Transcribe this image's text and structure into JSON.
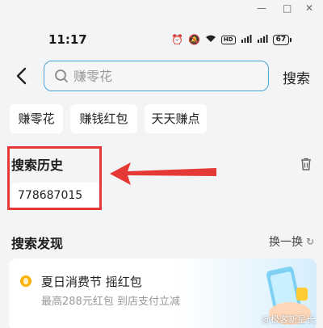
{
  "window": {
    "minimize_glyph": "—",
    "restore_glyph": "□",
    "close_glyph": "✕"
  },
  "status": {
    "time": "11:17",
    "icons": [
      "alarm-icon",
      "mute-icon",
      "wifi-icon",
      "hd-icon",
      "signal-5g-icon",
      "signal-4g-icon",
      "battery-icon"
    ],
    "hd_label": "HD",
    "battery_level": "67"
  },
  "header": {
    "search_placeholder": "赚零花",
    "search_button": "搜索"
  },
  "suggestions": [
    "赚零花",
    "赚钱红包",
    "天天赚点"
  ],
  "history": {
    "title": "搜索历史",
    "items": [
      "778687015"
    ]
  },
  "discover": {
    "title": "搜索发现",
    "refresh_label": "换一换",
    "card": {
      "title": "夏日消费节 摇红包",
      "subtitle": "最高288元红包 到店支付立减"
    }
  },
  "watermark": "@极客新星长",
  "colors": {
    "accent": "#4aa3d9",
    "annotation": "#e53935"
  }
}
